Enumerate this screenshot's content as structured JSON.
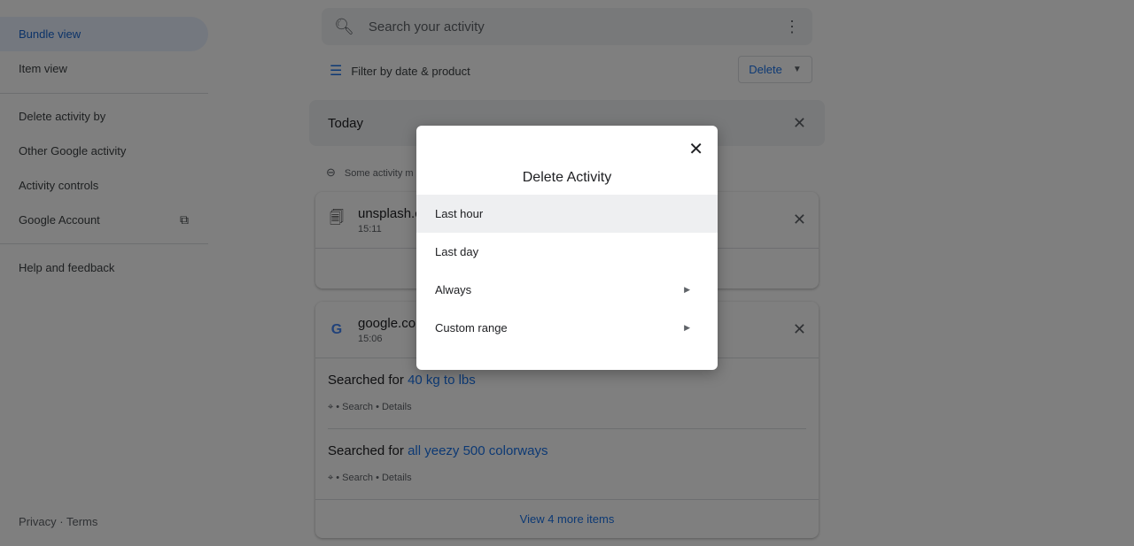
{
  "sidebar": {
    "items": [
      {
        "label": "Bundle view"
      },
      {
        "label": "Item view"
      },
      {
        "label": "Delete activity by"
      },
      {
        "label": "Other Google activity"
      },
      {
        "label": "Activity controls"
      },
      {
        "label": "Google Account"
      },
      {
        "label": "Help and feedback"
      }
    ],
    "footer": {
      "privacy": "Privacy",
      "sep": "·",
      "terms": "Terms"
    }
  },
  "search": {
    "placeholder": "Search your activity"
  },
  "filter": {
    "label": "Filter by date & product"
  },
  "delete_button": {
    "label": "Delete"
  },
  "today": {
    "label": "Today"
  },
  "note": "Some activity m",
  "cards": [
    {
      "title": "unsplash.c",
      "time": "15:11"
    },
    {
      "title": "google.co",
      "time": "15:06",
      "entries": [
        {
          "prefix": "Searched for",
          "query": "40 kg to lbs",
          "meta": "• Search • Details"
        },
        {
          "prefix": "Searched for",
          "query": "all yeezy 500 colorways",
          "meta": "• Search • Details"
        }
      ],
      "more": "View 4 more items"
    }
  ],
  "dialog": {
    "title": "Delete Activity",
    "options": [
      {
        "label": "Last hour"
      },
      {
        "label": "Last day"
      },
      {
        "label": "Always"
      },
      {
        "label": "Custom range"
      }
    ]
  },
  "colors": {
    "accent": "#1a73e8",
    "overlay": "rgba(0,0,0,0.5)"
  }
}
